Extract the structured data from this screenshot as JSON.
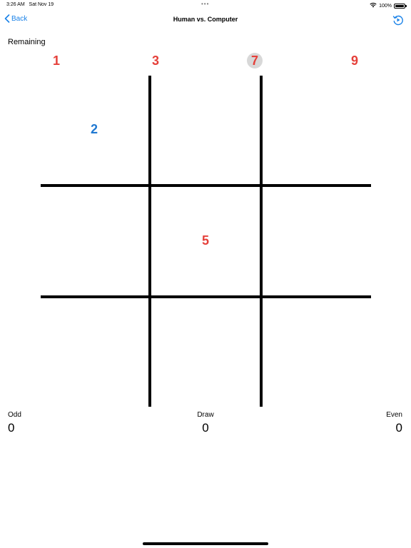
{
  "status": {
    "time": "3:26 AM",
    "date": "Sat Nov 19",
    "dots": "•••",
    "battery": "100%"
  },
  "nav": {
    "back_label": "Back",
    "title": "Human vs. Computer",
    "action_icon": "replay-icon"
  },
  "remaining": {
    "label": "Remaining",
    "numbers": [
      "1",
      "3",
      "7",
      "9"
    ],
    "selected": "7"
  },
  "board": {
    "cells": [
      "",
      "",
      "",
      "2",
      "",
      "",
      "",
      "5",
      "",
      "",
      "",
      ""
    ],
    "grid": [
      [
        "2",
        "",
        ""
      ],
      [
        "",
        "5",
        ""
      ],
      [
        "",
        "",
        ""
      ]
    ]
  },
  "score": {
    "odd_label": "Odd",
    "odd_value": "0",
    "draw_label": "Draw",
    "draw_value": "0",
    "even_label": "Even",
    "even_value": "0"
  },
  "colors": {
    "odd": "#e5403a",
    "even": "#1f78d1",
    "accent": "#1a82e8"
  }
}
